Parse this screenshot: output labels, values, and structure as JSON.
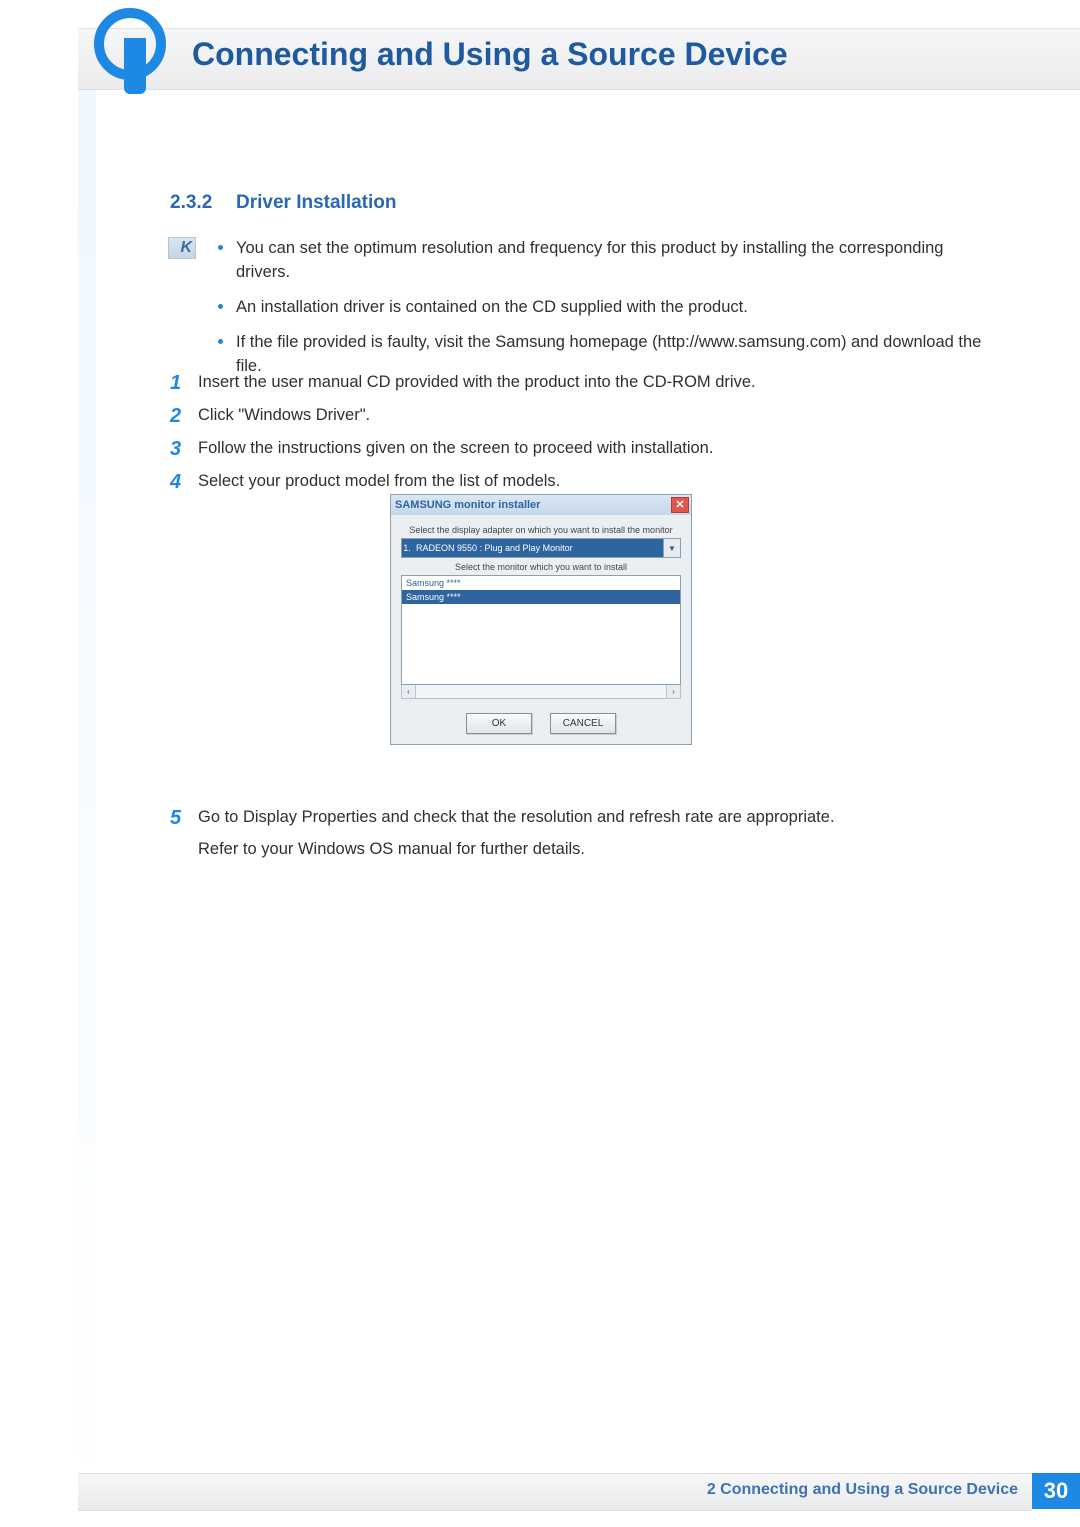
{
  "header": {
    "chapter_number": "2",
    "chapter_title": "Connecting and Using a Source Device"
  },
  "section": {
    "number": "2.3.2",
    "title": "Driver Installation"
  },
  "info_bullets": [
    "You can set the optimum resolution and frequency for this product by installing the corresponding drivers.",
    "An installation driver is contained on the CD supplied with the product.",
    "If the file provided is faulty, visit the Samsung homepage (http://www.samsung.com) and download the file."
  ],
  "steps": [
    {
      "n": "1",
      "text": "Insert the user manual CD provided with the product into the CD-ROM drive."
    },
    {
      "n": "2",
      "text": "Click \"Windows Driver\"."
    },
    {
      "n": "3",
      "text": "Follow the instructions given on the screen to proceed with installation."
    },
    {
      "n": "4",
      "text": "Select your product model from the list of models."
    },
    {
      "n": "5",
      "text": "Go to Display Properties and check that the resolution and refresh rate are appropriate.",
      "sub": "Refer to your Windows OS manual for further details."
    }
  ],
  "dialog": {
    "title": "SAMSUNG monitor installer",
    "label_adapter": "Select the display adapter on which you want to install the monitor",
    "adapter_index": "1.",
    "adapter_value": "RADEON 9550 : Plug and Play Monitor",
    "label_monitor": "Select the monitor which you want to install",
    "monitors": [
      "Samsung ****",
      "Samsung ****"
    ],
    "ok": "OK",
    "cancel": "CANCEL"
  },
  "footer": {
    "label": "2 Connecting and Using a Source Device",
    "page": "30"
  }
}
